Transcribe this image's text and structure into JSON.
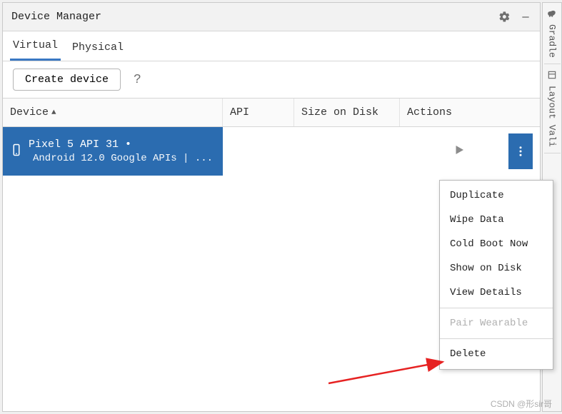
{
  "header": {
    "title": "Device Manager",
    "settings_icon": "gear",
    "minimize_icon": "minimize"
  },
  "tabs": {
    "virtual": "Virtual",
    "physical": "Physical",
    "active": "virtual"
  },
  "toolbar": {
    "create_label": "Create device",
    "help_label": "?"
  },
  "columns": {
    "device": "Device",
    "api": "API",
    "size": "Size on Disk",
    "actions": "Actions",
    "sort_asc_glyph": "▲"
  },
  "device_row": {
    "name": "Pixel 5 API 31 •",
    "description": "Android 12.0 Google APIs | ...",
    "api": "",
    "size": ""
  },
  "actions_row": {
    "play": "play",
    "more": "more-vertical"
  },
  "context_menu": {
    "items": [
      {
        "label": "Duplicate",
        "enabled": true
      },
      {
        "label": "Wipe Data",
        "enabled": true
      },
      {
        "label": "Cold Boot Now",
        "enabled": true
      },
      {
        "label": "Show on Disk",
        "enabled": true
      },
      {
        "label": "View Details",
        "enabled": true
      }
    ],
    "pair": {
      "label": "Pair Wearable",
      "enabled": false
    },
    "delete": {
      "label": "Delete",
      "enabled": true
    }
  },
  "side_tabs": {
    "gradle": "Gradle",
    "layout": "Layout Vali"
  },
  "watermark": "CSDN @形sir哥"
}
